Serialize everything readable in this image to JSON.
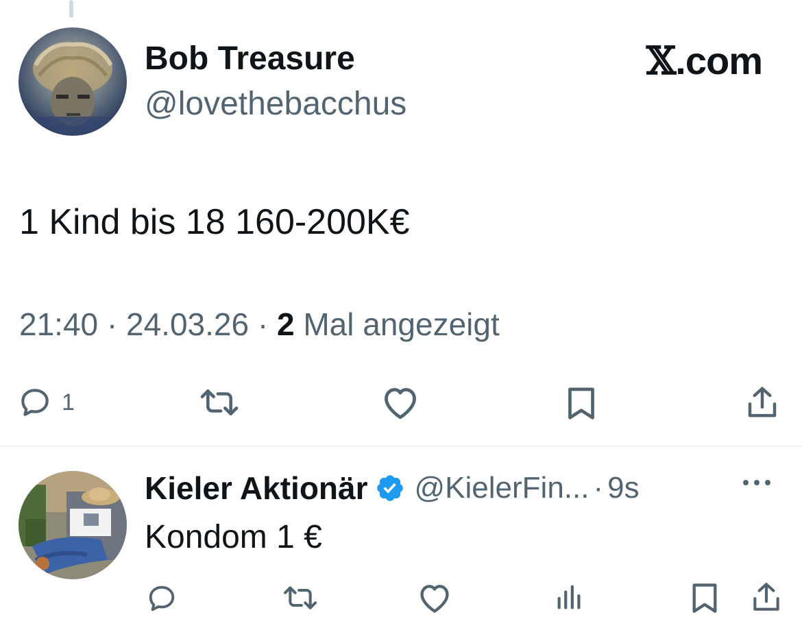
{
  "tweet": {
    "author_name": "Bob Treasure",
    "author_handle": "@lovethebacchus",
    "brand": {
      "mark": "𝕏",
      "suffix": ".com"
    },
    "text": "1 Kind bis 18 160-200K€",
    "time": "21:40",
    "separator": "·",
    "date": "24.03.26",
    "views_count": "2",
    "views_label": "Mal angezeigt",
    "actions": {
      "reply_count": "1",
      "icons": [
        "reply-icon",
        "retweet-icon",
        "like-icon",
        "bookmark-icon",
        "share-icon"
      ]
    }
  },
  "reply": {
    "author_name": "Kieler Aktionär",
    "verified": true,
    "author_handle": "@KielerFin...",
    "separator": "·",
    "time": "9s",
    "text": "Kondom 1 €",
    "icons": [
      "reply-icon",
      "retweet-icon",
      "like-icon",
      "views-icon",
      "bookmark-icon",
      "share-icon"
    ]
  },
  "colors": {
    "text_primary": "#0f1419",
    "text_secondary": "#536471",
    "verified_blue": "#1d9bf0",
    "divider": "#eff3f4"
  }
}
